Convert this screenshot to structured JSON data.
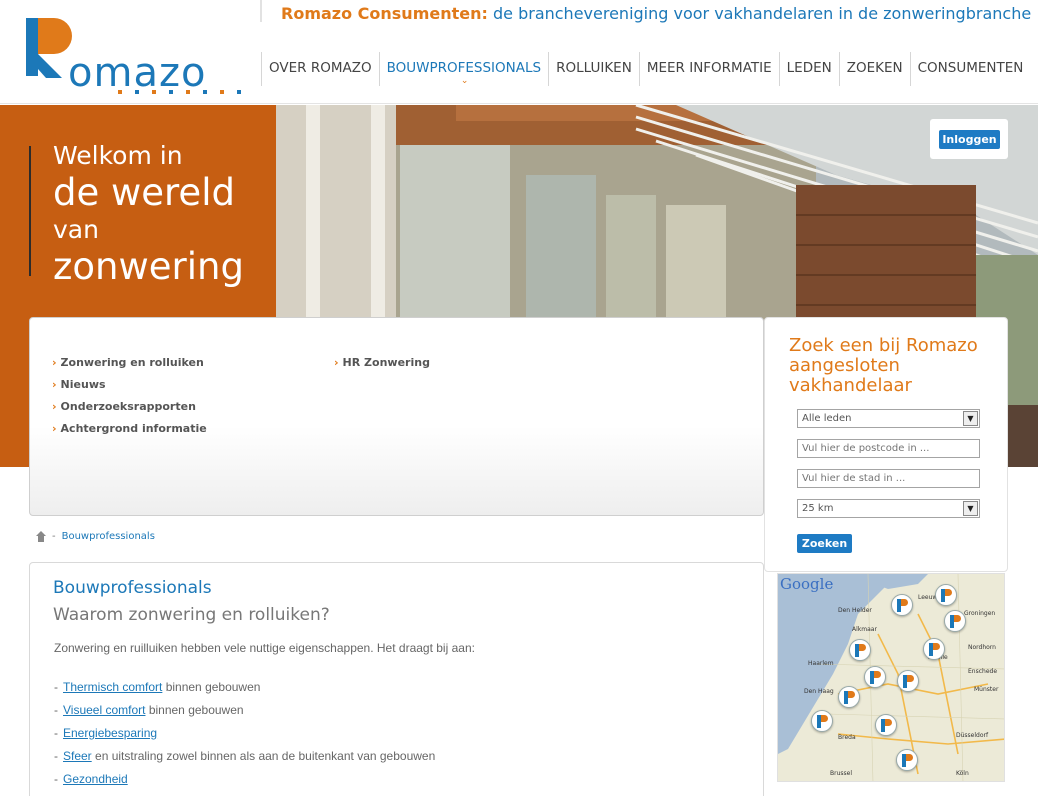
{
  "brand": {
    "logo_text": "omazo",
    "logo_dot_colors": [
      "#e07a1a",
      "#1c78b8",
      "#e07a1a",
      "#1c78b8",
      "#e07a1a",
      "#1c78b8",
      "#e07a1a",
      "#1c78b8"
    ],
    "tagline_strong": "Romazo Consumenten:",
    "tagline_rest": " de branchevereniging voor vakhandelaren in de zonweringbranche",
    "accent_orange": "#e07a1a",
    "accent_blue": "#1c78b8"
  },
  "nav": {
    "items": [
      {
        "label": "OVER ROMAZO"
      },
      {
        "label": "BOUWPROFESSIONALS",
        "active": true
      },
      {
        "label": "ROLLUIKEN"
      },
      {
        "label": "MEER INFORMATIE"
      },
      {
        "label": "LEDEN"
      },
      {
        "label": "ZOEKEN"
      },
      {
        "label": "CONSUMENTEN"
      }
    ],
    "active_caret": "⌄"
  },
  "hero": {
    "line1": "Welkom in",
    "line2": "de wereld",
    "line3": "van",
    "line4": "zonwering",
    "login_label": "Inloggen"
  },
  "links": {
    "col1": [
      "Zonwering en rolluiken",
      "Nieuws",
      "Onderzoeksrapporten",
      "Achtergrond informatie"
    ],
    "col2": [
      "HR Zonwering"
    ],
    "bullet": "›"
  },
  "search": {
    "title": "Zoek een bij Romazo aangesloten vakhandelaar",
    "member_select": "Alle leden",
    "postcode_placeholder": "Vul hier de postcode in ...",
    "city_placeholder": "Vul hier de stad in ...",
    "radius_select": "25 km",
    "submit_label": "Zoeken",
    "dropdown_glyph": "▼"
  },
  "map": {
    "google_label": "Google",
    "cities": [
      "Den Helder",
      "Leeuwarden",
      "Alkmaar",
      "Haarlem",
      "Den Haag",
      "Zwolle",
      "Enschede",
      "Groningen",
      "Münster",
      "Breda",
      "Düsseldorf",
      "Brussel",
      "Köln",
      "Nordhorn"
    ]
  },
  "breadcrumb": {
    "separator": "-",
    "current": "Bouwprofessionals"
  },
  "content": {
    "title": "Bouwprofessionals",
    "subtitle": "Waarom zonwering en rolluiken?",
    "intro": "Zonwering en ruilluiken hebben vele nuttige eigenschappen. Het draagt bij aan:",
    "dash": "-",
    "items": [
      {
        "link": "Thermisch comfort",
        "rest": " binnen gebouwen"
      },
      {
        "link": "Visueel comfort",
        "rest": " binnen gebouwen"
      },
      {
        "link": "Energiebesparing",
        "rest": ""
      },
      {
        "link": "Sfeer",
        "rest": " en uitstraling zowel binnen als aan de buitenkant van gebouwen"
      },
      {
        "link": "Gezondheid",
        "rest": ""
      }
    ]
  }
}
